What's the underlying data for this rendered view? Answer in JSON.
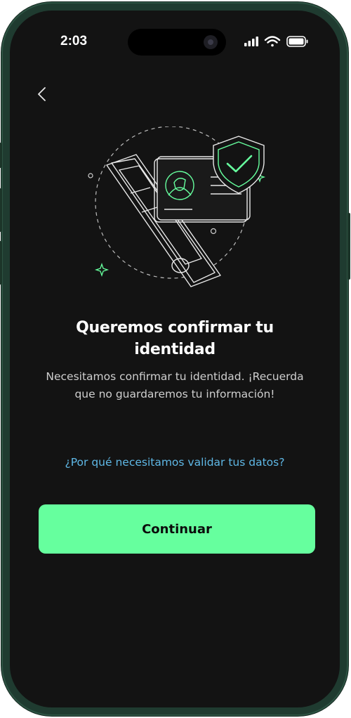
{
  "status_bar": {
    "time": "2:03",
    "icons": [
      "cellular-signal-icon",
      "wifi-icon",
      "battery-icon"
    ]
  },
  "nav": {
    "back_icon": "chevron-left-icon"
  },
  "content": {
    "title": "Queremos confirmar tu identidad",
    "description": "Necesitamos confirmar tu identidad. ¡Recuerda que no guardaremos tu información!",
    "help_link": "¿Por qué necesitamos validar tus datos?"
  },
  "actions": {
    "continue_label": "Continuar"
  },
  "colors": {
    "background": "#131313",
    "accent_green": "#66ff9e",
    "link_blue": "#5fb8e6",
    "phone_frame": "#1f3b30"
  }
}
